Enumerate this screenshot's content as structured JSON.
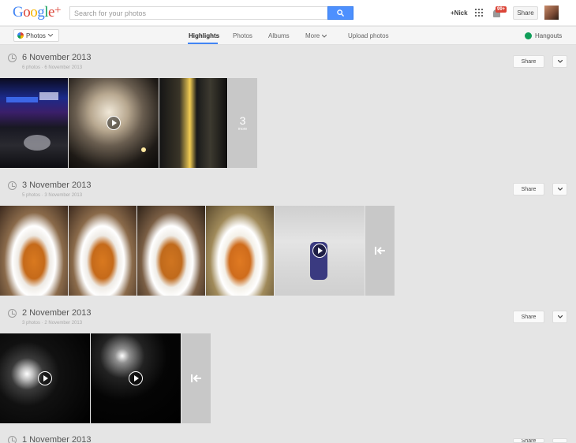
{
  "header": {
    "logo_text": "Google",
    "logo_plus": "+",
    "search_placeholder": "Search for your photos",
    "user_link": "+Nick",
    "notification_count": "99+",
    "share_label": "Share"
  },
  "subnav": {
    "photos_label": "Photos",
    "tabs": [
      {
        "label": "Highlights"
      },
      {
        "label": "Photos"
      },
      {
        "label": "Albums"
      },
      {
        "label": "More"
      },
      {
        "label": "Upload photos"
      }
    ],
    "hangouts_label": "Hangouts"
  },
  "sections": [
    {
      "date": "6 November 2013",
      "meta": "6 photos · 6 November 2013",
      "share_label": "Share",
      "more_count": "3",
      "more_label": "more"
    },
    {
      "date": "3 November 2013",
      "meta": "5 photos · 3 November 2013",
      "share_label": "Share"
    },
    {
      "date": "2 November 2013",
      "meta": "3 photos · 2 November 2013",
      "share_label": "Share"
    },
    {
      "date": "1 November 2013",
      "share_label": "Share"
    }
  ]
}
